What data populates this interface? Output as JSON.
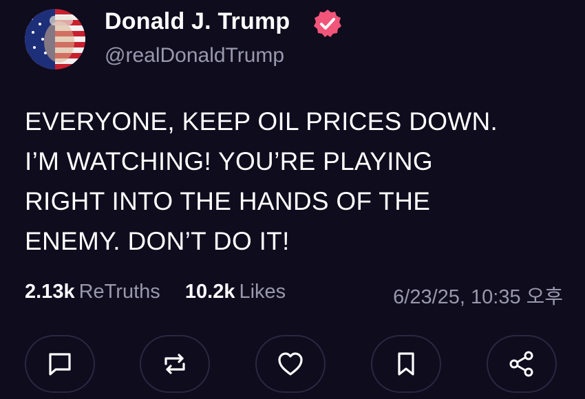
{
  "post": {
    "author": {
      "display_name": "Donald J. Trump",
      "handle": "@realDonaldTrump",
      "verified": true
    },
    "body_lines": [
      "EVERYONE, KEEP OIL PRICES DOWN.",
      "I’M WATCHING! YOU’RE PLAYING",
      "RIGHT INTO THE HANDS OF THE",
      "ENEMY. DON’T DO IT!"
    ],
    "stats": {
      "retruths_count": "2.13k",
      "retruths_label": "ReTruths",
      "likes_count": "10.2k",
      "likes_label": "Likes"
    },
    "timestamp": "6/23/25, 10:35 오후"
  },
  "actions": [
    {
      "icon": "reply-icon"
    },
    {
      "icon": "retruth-icon"
    },
    {
      "icon": "like-icon"
    },
    {
      "icon": "bookmark-icon"
    },
    {
      "icon": "share-icon"
    }
  ],
  "colors": {
    "background": "#0e0c1d",
    "primary_text": "#ffffff",
    "secondary_text": "#9a98ad",
    "verified_badge": "#f2557a",
    "button_border": "#2a2840"
  }
}
